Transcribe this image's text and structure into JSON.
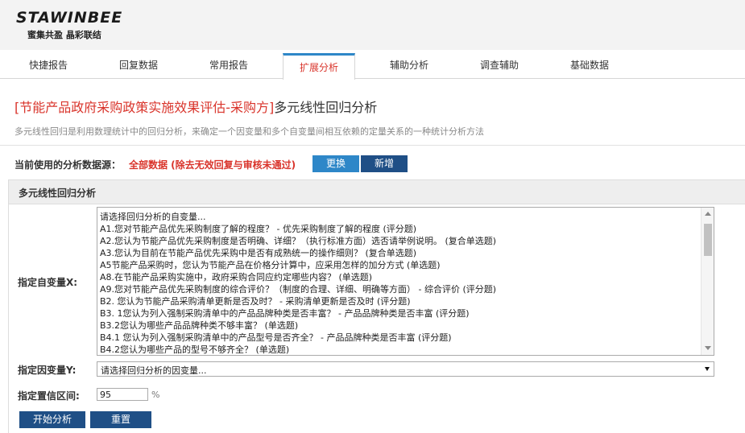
{
  "brand": {
    "logo_text": "STAWINBEE",
    "tagline": "蜜集共盈 晶彩联结"
  },
  "tabs": [
    {
      "label": "快捷报告",
      "active": false
    },
    {
      "label": "回复数据",
      "active": false
    },
    {
      "label": "常用报告",
      "active": false
    },
    {
      "label": "扩展分析",
      "active": true
    },
    {
      "label": "辅助分析",
      "active": false
    },
    {
      "label": "调查辅助",
      "active": false
    },
    {
      "label": "基础数据",
      "active": false
    }
  ],
  "page": {
    "title_red": "[节能产品政府采购政策实施效果评估-采购方]",
    "title_rest": "多元线性回归分析",
    "description": "多元线性回归是利用数理统计中的回归分析，来确定一个因变量和多个自变量间相互依赖的定量关系的一种统计分析方法"
  },
  "datasource": {
    "label": "当前使用的分析数据源：",
    "value": "全部数据 (除去无效回复与审核未通过)",
    "change_button": "更换",
    "new_button": "新增"
  },
  "panel": {
    "title": "多元线性回归分析",
    "x_label": "指定自变量X:",
    "x_options": [
      "请选择回归分析的自变量...",
      "A1.您对节能产品优先采购制度了解的程度？ - 优先采购制度了解的程度 (评分题)",
      "A2.您认为节能产品优先采购制度是否明确、详细？（执行标准方面）选否请举例说明。 (复合单选题)",
      "A3.您认为目前在节能产品优先采购中是否有成熟统一的操作细则？ (复合单选题)",
      "A5节能产品采购时，您认为节能产品在价格分计算中，应采用怎样的加分方式 (单选题)",
      "A8.在节能产品采购实施中，政府采购合同应约定哪些内容？ (单选题)",
      "A9.您对节能产品优先采购制度的综合评价？（制度的合理、详细、明确等方面） - 综合评价 (评分题)",
      "B2. 您认为节能产品采购清单更新是否及时？ - 采购清单更新是否及时 (评分题)",
      "B3. 1您认为列入强制采购清单中的产品品牌种类是否丰富？ - 产品品牌种类是否丰富 (评分题)",
      "B3.2您认为哪些产品品牌种类不够丰富？ (单选题)",
      "B4.1 您认为列入强制采购清单中的产品型号是否齐全？ - 产品品牌种类是否丰富 (评分题)",
      "B4.2您认为哪些产品的型号不够齐全？ (单选题)"
    ],
    "y_label": "指定因变量Y:",
    "y_selected": "请选择回归分析的因变量...",
    "conf_label": "指定置信区间:",
    "conf_value": "95",
    "conf_unit": "%",
    "start_button": "开始分析",
    "reset_button": "重置"
  }
}
